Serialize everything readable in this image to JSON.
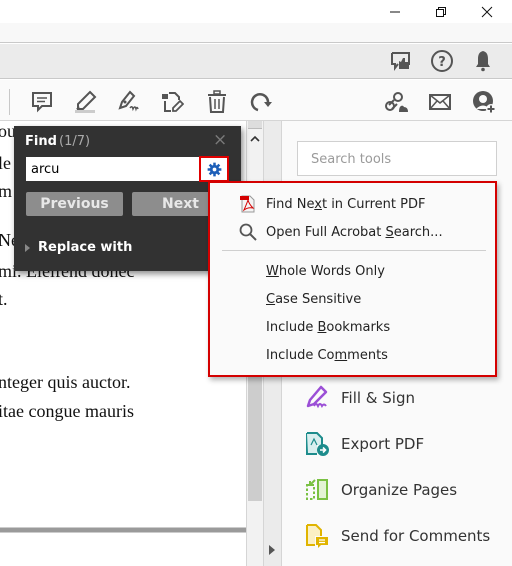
{
  "window": {
    "controls": {
      "minimize": "minimize-icon",
      "restore": "restore-icon",
      "close": "close-icon"
    }
  },
  "appbar": {
    "icons": [
      "feedback-thumbs-up-icon",
      "help-icon",
      "notification-bell-icon"
    ]
  },
  "toolbar": {
    "left_icons": [
      "comment-icon",
      "highlight-icon",
      "sign-pen-icon",
      "edit-document-icon",
      "delete-trash-icon",
      "rotate-icon"
    ],
    "right_icons": [
      "share-link-cloud-icon",
      "email-icon",
      "add-user-icon"
    ]
  },
  "document": {
    "lines": [
      "Ne",
      "mi. Eleifend donec",
      "t.",
      "nteger quis auctor.",
      "itae congue mauris"
    ],
    "partial_lines_behind_panel": [
      "ou",
      "le",
      "m"
    ]
  },
  "find": {
    "title": "Find",
    "count": "(1/7)",
    "close": "×",
    "query": "arcu",
    "previous_label": "Previous",
    "next_label": "Next",
    "replace_label": "Replace with"
  },
  "options_menu": {
    "items": [
      {
        "label_pre": "Find Ne",
        "label_u": "x",
        "label_post": "t in Current PDF",
        "icon": "pdf-icon"
      },
      {
        "label_pre": "Open Full Acrobat ",
        "label_u": "S",
        "label_post": "earch...",
        "icon": "search-icon"
      },
      {
        "label_pre": "",
        "label_u": "W",
        "label_post": "hole Words Only"
      },
      {
        "label_pre": "",
        "label_u": "C",
        "label_post": "ase Sensitive"
      },
      {
        "label_pre": "Include ",
        "label_u": "B",
        "label_post": "ookmarks"
      },
      {
        "label_pre": "Include Co",
        "label_u": "m",
        "label_post": "ments"
      }
    ]
  },
  "tools_pane": {
    "search_placeholder": "Search tools",
    "items": [
      {
        "label": "Fill & Sign",
        "icon": "fill-sign-icon",
        "color": "#9b4fd6"
      },
      {
        "label": "Export PDF",
        "icon": "export-pdf-icon",
        "color": "#1d8c8c"
      },
      {
        "label": "Organize Pages",
        "icon": "organize-pages-icon",
        "color": "#7ac143"
      },
      {
        "label": "Send for Comments",
        "icon": "send-for-comments-icon",
        "color": "#e0b400"
      }
    ]
  },
  "colors": {
    "highlight_border": "#d40000",
    "find_panel_bg": "#323232",
    "gear_blue": "#1d5fb8"
  }
}
